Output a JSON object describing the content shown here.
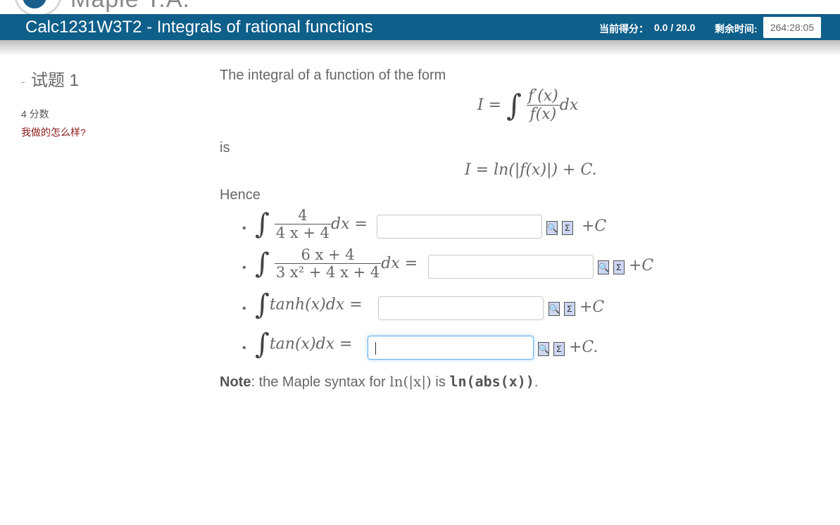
{
  "logo": {
    "text": "Maple T.A."
  },
  "header": {
    "title": "Calc1231W3T2 - Integrals of rational functions",
    "score_label": "当前得分：",
    "score_value": "0.0 / 20.0",
    "time_label": "剩余时间:",
    "time_value": "264:28:05"
  },
  "question": {
    "dash": "-",
    "title": "试题 1",
    "points": "4 分数",
    "how_did_i_do": "我做的怎么样?"
  },
  "body": {
    "intro": "The integral of a function of the form",
    "is": "is",
    "hence": "Hence",
    "formula1_lhs": "I =",
    "formula1_num": "f′(x)",
    "formula1_den": "f(x)",
    "formula1_dx": "dx",
    "formula2": "I = ln(|f(x)|) + C."
  },
  "items": [
    {
      "num": "4",
      "den": "4 x + 4",
      "tail": "dx =",
      "value": "",
      "suffix": "+C"
    },
    {
      "num": "6 x + 4",
      "den": "3 x² + 4 x + 4",
      "tail": "dx =",
      "value": "",
      "suffix": "+C"
    },
    {
      "expr": "tanh(x)dx =",
      "value": "",
      "suffix": "+C"
    },
    {
      "expr": "tan(x)dx =",
      "value": "",
      "suffix": "+C."
    }
  ],
  "icons": {
    "preview": "preview-icon",
    "equation": "equation-editor-icon",
    "preview_glyph": "🔍",
    "equation_glyph": "Σ"
  },
  "note": {
    "label": "Note",
    "text1": ": the Maple syntax for ",
    "math": "ln(|x|)",
    "text2": " is ",
    "code": "ln(abs(x))",
    "end": "."
  }
}
